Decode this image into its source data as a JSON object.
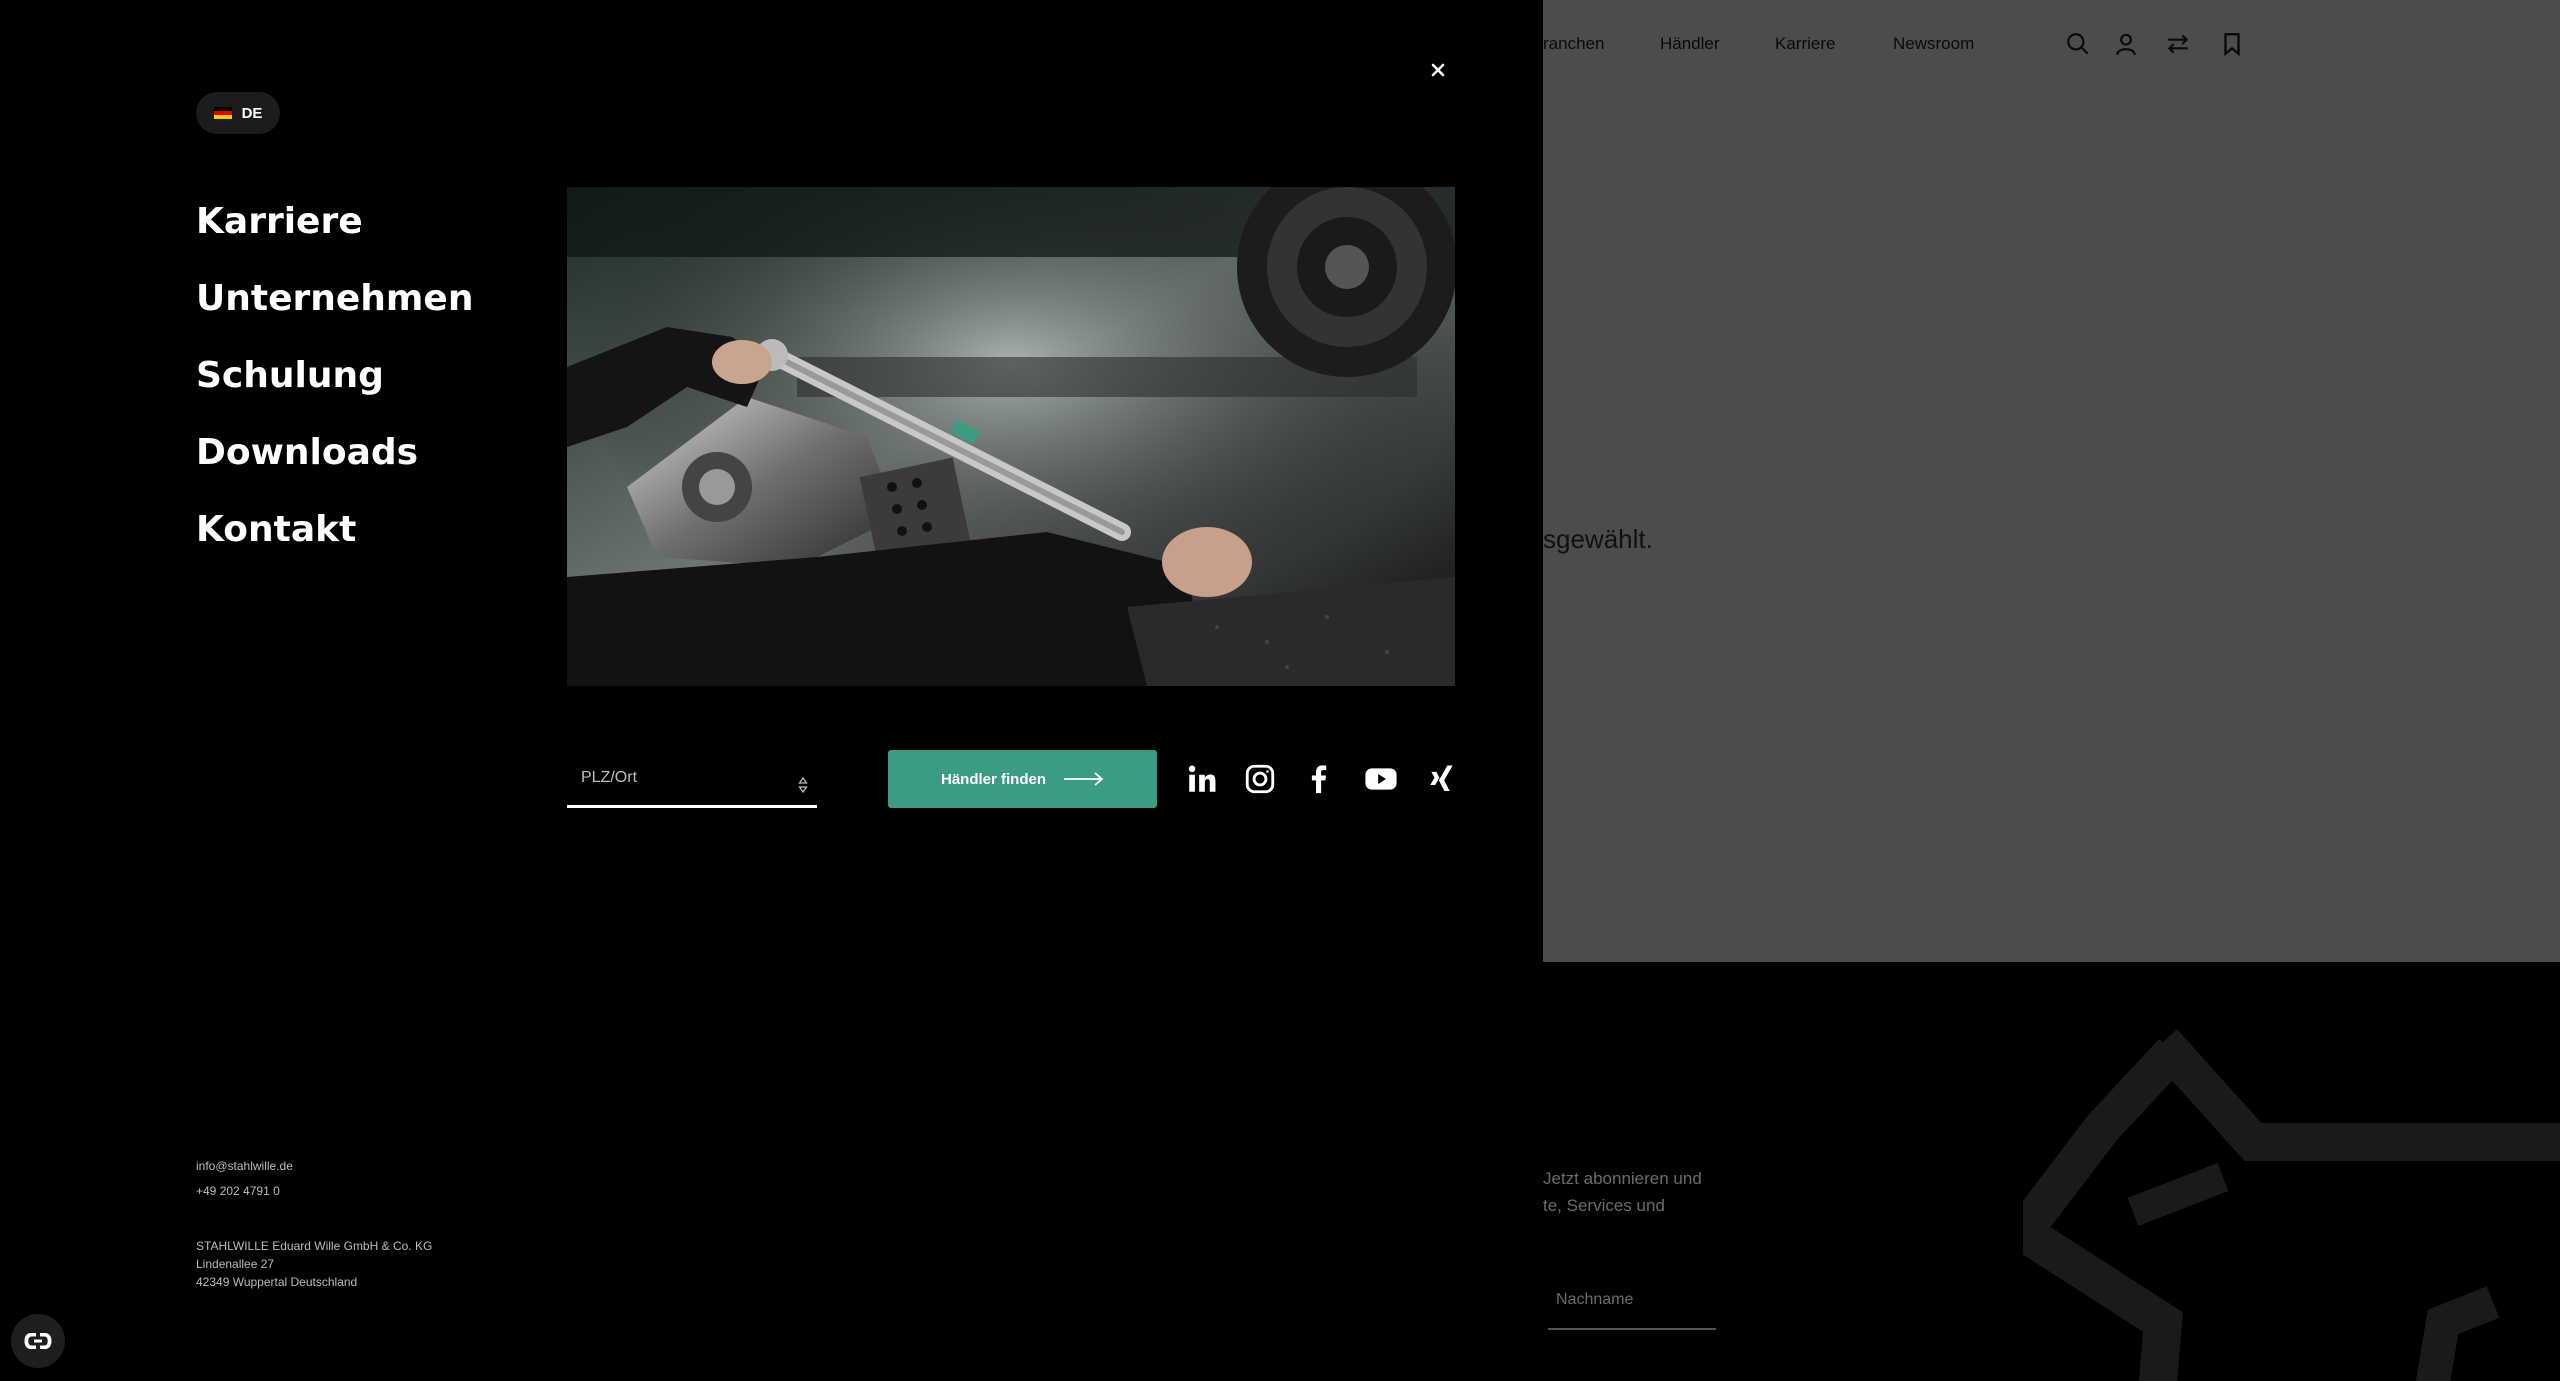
{
  "background_page": {
    "nav_items": [
      "ranchen",
      "Händler",
      "Karriere",
      "Newsroom"
    ],
    "nav_icons": [
      "search-icon",
      "user-icon",
      "compare-icon",
      "bookmark-icon"
    ],
    "body_text": "sgewählt.",
    "newsletter_lines": [
      "Jetzt abonnieren und",
      "te, Services und"
    ],
    "lastname_placeholder": "Nachname"
  },
  "menu": {
    "language": {
      "code": "DE",
      "flag_colors": [
        "#000000",
        "#dd0000",
        "#ffce00"
      ]
    },
    "close_icon": "close-icon",
    "nav_links": [
      "Karriere",
      "Unternehmen",
      "Schulung",
      "Downloads",
      "Kontakt"
    ],
    "dealer_search": {
      "placeholder": "PLZ/Ort",
      "button_label": "Händler finden"
    },
    "social_icons": [
      "linkedin-icon",
      "instagram-icon",
      "facebook-icon",
      "youtube-icon",
      "xing-icon"
    ],
    "contact": {
      "email": "info@stahlwille.de",
      "phone": "+49 202 4791 0",
      "company": "STAHLWILLE Eduard Wille GmbH & Co. KG",
      "street": "Lindenallee 27",
      "city": "42349 Wuppertal Deutschland"
    }
  },
  "accessibility_button_icon": "accessibility-icon",
  "colors": {
    "accent": "#3b9b83",
    "panel": "#000000",
    "dim_overlay": "#4c4c4c"
  }
}
